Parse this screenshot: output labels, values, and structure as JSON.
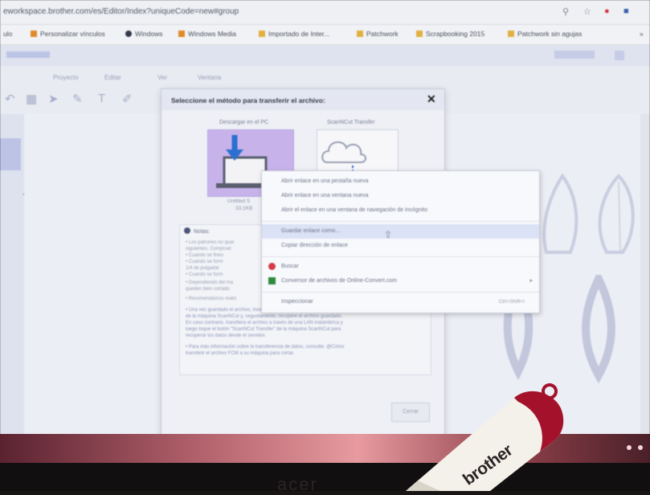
{
  "browser": {
    "url": "eworkspace.brother.com/es/Editor/Index?uniqueCode=new#group",
    "bookmarks": [
      {
        "label": "ulo",
        "color": "#8b8e99"
      },
      {
        "label": "Personalizar vínculos",
        "color": "#e08a2b"
      },
      {
        "label": "Windows",
        "color": "#333a4a"
      },
      {
        "label": "Windows Media",
        "color": "#e08a2b"
      },
      {
        "label": "Importado de Inter...",
        "color": "#e2b040"
      },
      {
        "label": "Patchwork",
        "color": "#e2b040"
      },
      {
        "label": "Scrapbooking 2015",
        "color": "#e2b040"
      },
      {
        "label": "Patchwork sin agujas",
        "color": "#e2b040"
      }
    ],
    "bookmarks_more": "»"
  },
  "app": {
    "menu": [
      "Proyecto",
      "Editar",
      "Ver",
      "Ventana"
    ]
  },
  "dialog": {
    "title": "Seleccione el método para transferir el archivo:",
    "close": "✕",
    "option_download": "Descargar en el PC",
    "option_scan": "ScanNCut Transfer",
    "file_name": "Untitled S",
    "file_size": "33.1KB",
    "notes_title": "Notas:",
    "notes": [
      "• Los patrones no quar",
      "  siguientes. Compruet",
      "    • Cuando se fines",
      "    • Cuando se form",
      "      1/4 de pulgadat",
      "    • Cuando se form",
      "• Dependiendo del ma",
      "  queden bien cortado",
      "• Recomendamos realiz",
      "• Una vez guardado el archivo, inserte el dispositivo USB en el puerto USB",
      "  de la máquina ScanNCut y, seguidamente, recupere el archivo guardado.",
      "  En caso contrario, transfiera el archivo a través de una LAN inalámbrica y",
      "  luego toque el botón \"ScanNCut Transfer\" de la máquina ScanNCut para",
      "  recuperar los datos desde el servidor.",
      "• Para más información sobre la transferencia de datos, consulte: @Cómo",
      "  transferir el archivo FCM a su máquina para cortar."
    ],
    "close_button": "Cerrar"
  },
  "context_menu": {
    "items": [
      {
        "label": "Abrir enlace en una pestaña nueva"
      },
      {
        "label": "Abrir enlace en una ventana nueva"
      },
      {
        "label": "Abrir el enlace en una ventana de navegación de incógnito"
      },
      {
        "label": "Guardar enlace como..."
      },
      {
        "label": "Copiar dirección de enlace"
      },
      {
        "label": "Buscar"
      },
      {
        "label": "Conversor de archivos de Online-Convert.com"
      },
      {
        "label": "Inspeccionar",
        "shortcut": "Ctrl+Shift+I"
      }
    ]
  },
  "usb": {
    "brand": "brother"
  },
  "monitor": {
    "brand": "acer"
  },
  "colors": {
    "accent_tile": "#c7b3ea",
    "usb_red": "#a3112a",
    "download_icon": "#2d6fd1"
  }
}
